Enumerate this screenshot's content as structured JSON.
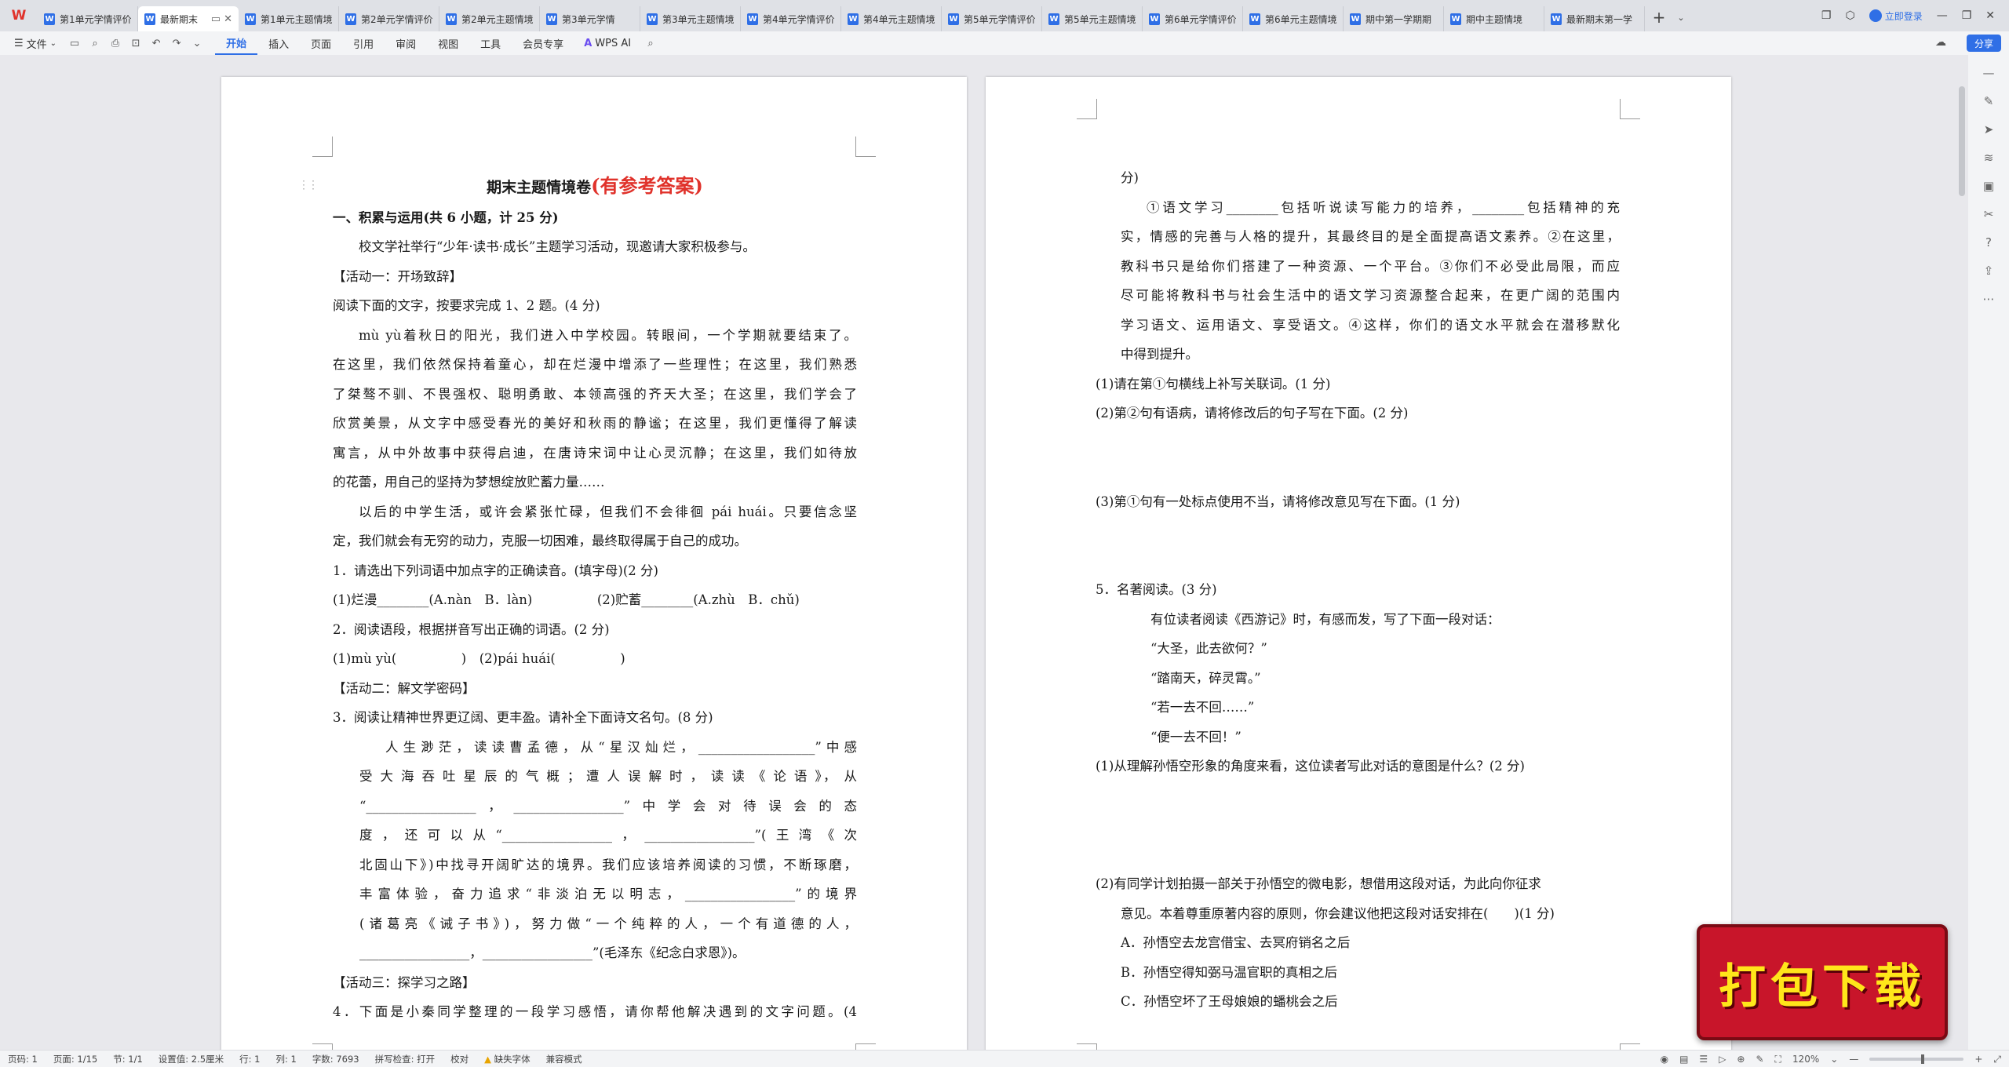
{
  "tabbar": {
    "logo": "W",
    "tabs": [
      {
        "label": "第1单元学情评价",
        "active": false
      },
      {
        "label": "最新期末",
        "active": true
      },
      {
        "label": "第1单元主题情境",
        "active": false
      },
      {
        "label": "第2单元学情评价",
        "active": false
      },
      {
        "label": "第2单元主题情境",
        "active": false
      },
      {
        "label": "第3单元学情",
        "active": false
      },
      {
        "label": "第3单元主题情境",
        "active": false
      },
      {
        "label": "第4单元学情评价",
        "active": false
      },
      {
        "label": "第4单元主题情境",
        "active": false
      },
      {
        "label": "第5单元学情评价",
        "active": false
      },
      {
        "label": "第5单元主题情境",
        "active": false
      },
      {
        "label": "第6单元学情评价",
        "active": false
      },
      {
        "label": "第6单元主题情境",
        "active": false
      },
      {
        "label": "期中第一学期期",
        "active": false
      },
      {
        "label": "期中主题情境",
        "active": false
      },
      {
        "label": "最新期末第一学",
        "active": false
      }
    ],
    "add_tab": "+",
    "login_label": "立即登录"
  },
  "toolbar": {
    "file_menu": "文件",
    "ribbon_tabs": [
      "开始",
      "插入",
      "页面",
      "引用",
      "审阅",
      "视图",
      "工具",
      "会员专享"
    ],
    "active_ribbon": "开始",
    "wps_ai": "WPS AI",
    "share": "分享"
  },
  "document": {
    "left_page": {
      "title": "期末主题情境卷",
      "title_red": "(有参考答案)",
      "lines": [
        "一、积累与运用(共 6 小题，计 25 分)",
        "校文学社举行“少年·读书·成长”主题学习活动，现邀请大家积极参与。",
        "【活动一：开场致辞】",
        "阅读下面的文字，按要求完成 1、2 题。(4 分)",
        "mù yù着秋日的阳光，我们进入中学校园。转眼间，一个学期就要结束了。",
        "在这里，我们依然保持着童心，却在烂漫中增添了一些理性；在这里，我们熟悉",
        "了桀骜不驯、不畏强权、聪明勇敢、本领高强的齐天大圣；在这里，我们学会了",
        "欣赏美景，从文字中感受春光的美好和秋雨的静谧；在这里，我们更懂得了解读",
        "寓言，从中外故事中获得启迪，在唐诗宋词中让心灵沉静；在这里，我们如待放",
        "的花蕾，用自己的坚持为梦想绽放贮蓄力量……",
        "以后的中学生活，或许会紧张忙碌，但我们不会徘徊 pái huái。只要信念坚",
        "定，我们就会有无穷的动力，克服一切困难，最终取得属于自己的成功。",
        "1．请选出下列词语中加点字的正确读音。(填字母)(2 分)",
        "(1)烂漫________(A.nàn　B．làn)　　　　　(2)贮蓄________(A.zhù　B．chǔ)",
        "2．阅读语段，根据拼音写出正确的词语。(2 分)",
        "(1)mù yù(　　　　　)　(2)pái huái(　　　　　)",
        "【活动二：解文学密码】",
        "3．阅读让精神世界更辽阔、更丰盈。请补全下面诗文名句。(8 分)",
        "人生渺茫，读读曹孟德，从“星汉灿烂，__________________”中感",
        "受 大 海 吞 吐 星 辰 的 气 概 ； 遭 人 误 解 时 ， 读 读 《 论 语 》， 从",
        "“_________________，_________________”中学会对待误会的态",
        "度，还可以从“_________________，_________________”(王湾《次",
        "北固山下》)中找寻开阔旷达的境界。我们应该培养阅读的习惯，不断琢磨，",
        "丰富体验，奋力追求“非淡泊无以明志，_________________”的境界",
        "(诸葛亮《诫子书》)，努力做“一个纯粹的人，一个有道德的人，",
        "_________________，_________________”(毛泽东《纪念白求恩》)。",
        "【活动三：探学习之路】",
        "4．下面是小秦同学整理的一段学习感悟，请你帮他解决遇到的文字问题。(4"
      ]
    },
    "right_page": {
      "lines": [
        "分)",
        "①语文学习________包括听说读写能力的培养，________包括精神的充",
        "实，情感的完善与人格的提升，其最终目的是全面提高语文素养。②在这里，",
        "教科书只是给你们搭建了一种资源、一个平台。③你们不必受此局限，而应",
        "尽可能将教科书与社会生活中的语文学习资源整合起来，在更广阔的范围内",
        "学习语文、运用语文、享受语文。④这样，你们的语文水平就会在潜移默化",
        "中得到提升。",
        "(1)请在第①句横线上补写关联词。(1 分)",
        "(2)第②句有语病，请将修改后的句子写在下面。(2 分)",
        "",
        "",
        "(3)第①句有一处标点使用不当，请将修改意见写在下面。(1 分)",
        "",
        "",
        "5．名著阅读。(3 分)",
        "有位读者阅读《西游记》时，有感而发，写了下面一段对话：",
        "“大圣，此去欲何？”",
        "“踏南天，碎灵霄。”",
        "“若一去不回……”",
        "“便一去不回！”",
        "(1)从理解孙悟空形象的角度来看，这位读者写此对话的意图是什么？(2 分)",
        "",
        "",
        "",
        "(2)有同学计划拍摄一部关于孙悟空的微电影，想借用这段对话，为此向你征求",
        "意见。本着尊重原著内容的原则，你会建议他把这段对话安排在(　　)(1 分)",
        "A．孙悟空去龙宫借宝、去冥府销名之后",
        "B．孙悟空得知弼马温官职的真相之后",
        "C．孙悟空坏了王母娘娘的蟠桃会之后"
      ]
    }
  },
  "statusbar": {
    "page": "页码: 1",
    "pages": "页面: 1/15",
    "section": "节: 1/1",
    "settings": "设置值: 2.5厘米",
    "row": "行: 1",
    "col": "列: 1",
    "words": "字数: 7693",
    "spellcheck": "拼写检查: 打开",
    "proofread": "校对",
    "missing_font": "缺失字体",
    "compat": "兼容模式",
    "zoom": "120%",
    "zoom_level": 0.55
  },
  "overlay": {
    "banner_text": "打包下载"
  },
  "colors": {
    "accent": "#2f6fe6",
    "title_red": "#e0322b",
    "banner_bg": "#c8152a",
    "banner_text": "#ffe61a"
  }
}
